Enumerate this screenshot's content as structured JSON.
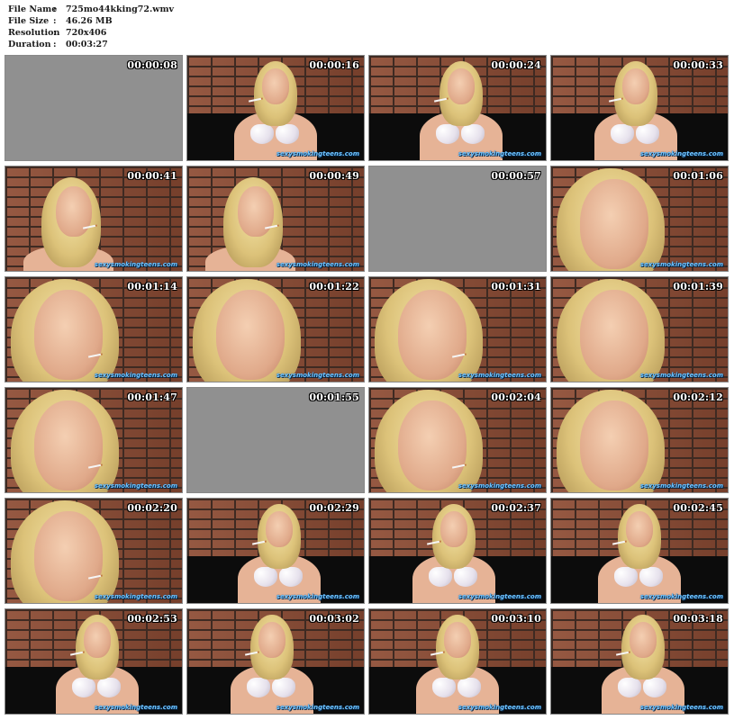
{
  "info": {
    "separator": ":",
    "rows": [
      {
        "label": "File Name",
        "value": "725mo44kking72.wmv"
      },
      {
        "label": "File Size",
        "value": "46.26 MB"
      },
      {
        "label": "Resolution",
        "value": "720x406"
      },
      {
        "label": "Duration",
        "value": "00:03:27"
      }
    ]
  },
  "watermark": "sexysmokingteens.com",
  "thumbnails": [
    {
      "time": "00:00:08",
      "scene": "grey",
      "watermark": false
    },
    {
      "time": "00:00:16",
      "scene": "wide",
      "watermark": true
    },
    {
      "time": "00:00:24",
      "scene": "wide",
      "watermark": true
    },
    {
      "time": "00:00:33",
      "scene": "wide",
      "watermark": true
    },
    {
      "time": "00:00:41",
      "scene": "medium",
      "watermark": true
    },
    {
      "time": "00:00:49",
      "scene": "medium",
      "watermark": true
    },
    {
      "time": "00:00:57",
      "scene": "grey",
      "watermark": false
    },
    {
      "time": "00:01:06",
      "scene": "closeup",
      "watermark": true
    },
    {
      "time": "00:01:14",
      "scene": "closeup",
      "watermark": true
    },
    {
      "time": "00:01:22",
      "scene": "closeup",
      "watermark": true
    },
    {
      "time": "00:01:31",
      "scene": "closeup",
      "watermark": true
    },
    {
      "time": "00:01:39",
      "scene": "closeup",
      "watermark": true
    },
    {
      "time": "00:01:47",
      "scene": "closeup",
      "watermark": true
    },
    {
      "time": "00:01:55",
      "scene": "grey",
      "watermark": false
    },
    {
      "time": "00:02:04",
      "scene": "closeup",
      "watermark": true
    },
    {
      "time": "00:02:12",
      "scene": "closeup",
      "watermark": true
    },
    {
      "time": "00:02:20",
      "scene": "closeup",
      "watermark": true
    },
    {
      "time": "00:02:29",
      "scene": "wide",
      "watermark": true
    },
    {
      "time": "00:02:37",
      "scene": "wide",
      "watermark": true
    },
    {
      "time": "00:02:45",
      "scene": "wide",
      "watermark": true
    },
    {
      "time": "00:02:53",
      "scene": "wide",
      "watermark": true
    },
    {
      "time": "00:03:02",
      "scene": "wide",
      "watermark": true
    },
    {
      "time": "00:03:10",
      "scene": "wide",
      "watermark": true
    },
    {
      "time": "00:03:18",
      "scene": "wide",
      "watermark": true
    }
  ]
}
